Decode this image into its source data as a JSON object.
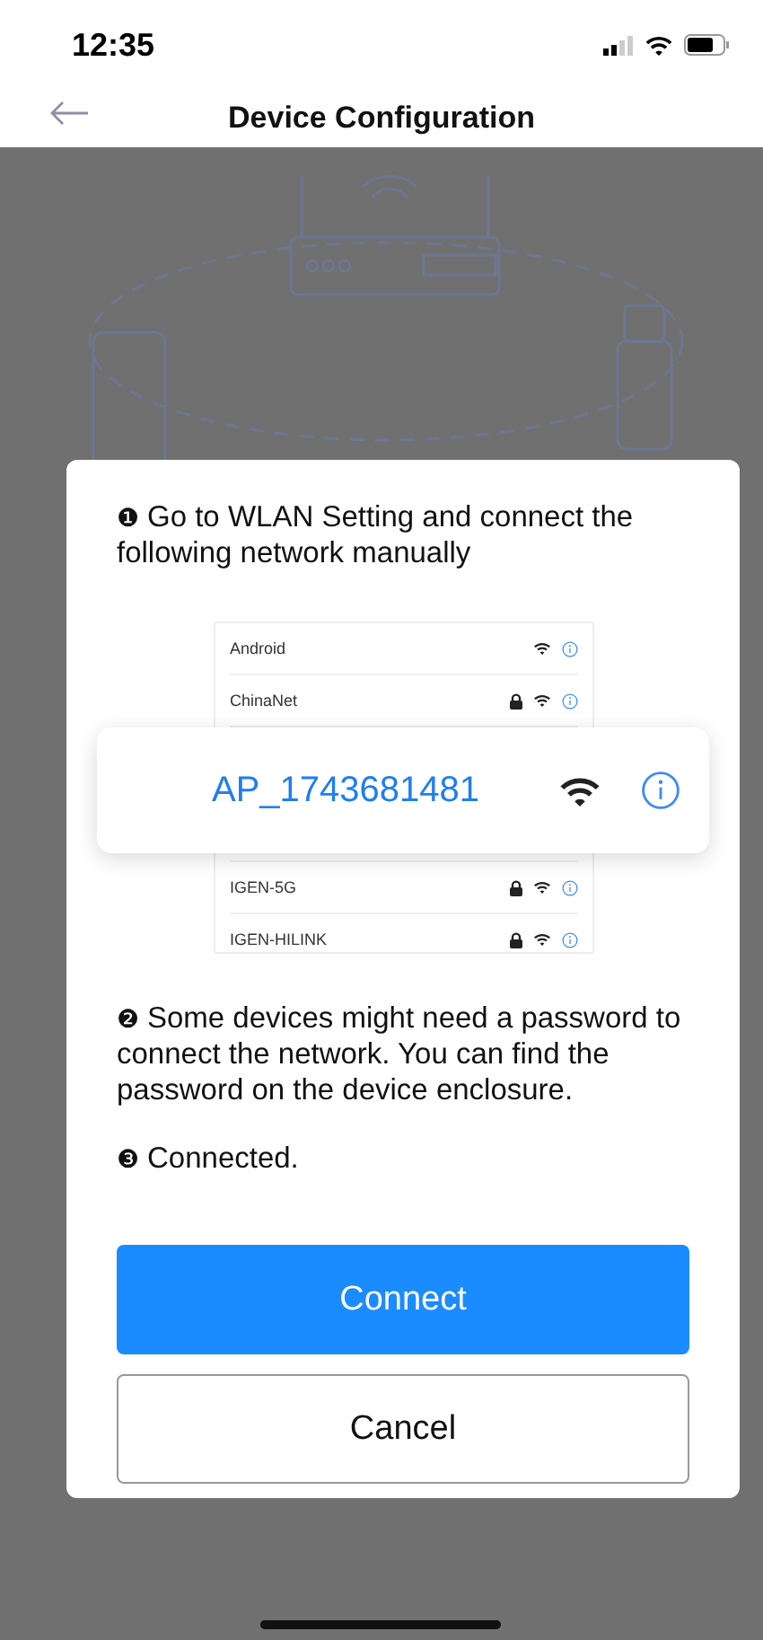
{
  "status_bar": {
    "time": "12:35"
  },
  "nav": {
    "title": "Device Configuration"
  },
  "dialog": {
    "steps": [
      {
        "marker": "❶",
        "text": "Go to WLAN Setting and connect the following network manually"
      },
      {
        "marker": "❷",
        "text": "Some devices might need a password to connect the network. You can find the password on the device enclosure."
      },
      {
        "marker": "❸",
        "text": "Connected."
      }
    ],
    "networks": [
      {
        "name": "Android",
        "locked": false
      },
      {
        "name": "ChinaNet",
        "locked": true
      },
      {
        "name": "IGEN-5G",
        "locked": true
      },
      {
        "name": "IGEN-HILINK",
        "locked": true
      }
    ],
    "highlighted_network": {
      "name": "AP_1743681481"
    },
    "buttons": [
      {
        "label": "Connect",
        "kind": "primary"
      },
      {
        "label": "Cancel",
        "kind": "secondary"
      }
    ]
  }
}
